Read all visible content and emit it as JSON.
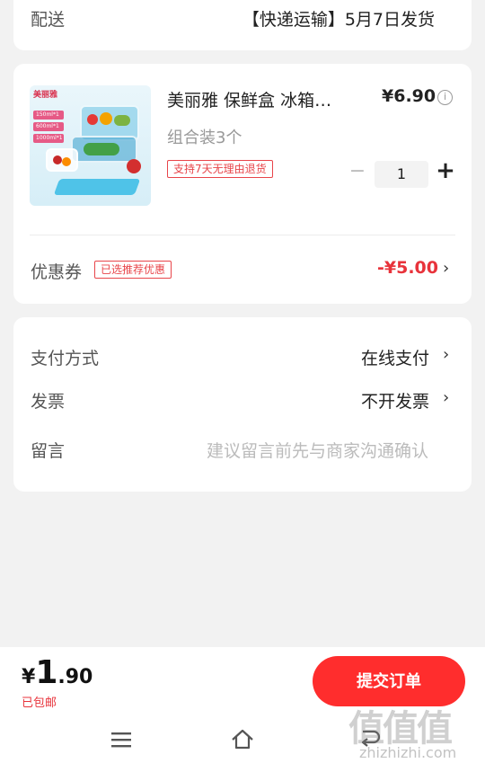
{
  "shipping": {
    "label": "配送",
    "value": "【快递运输】5月7日发货"
  },
  "product": {
    "title": "美丽雅  保鲜盒  冰箱…",
    "subtitle": "组合装3个",
    "badge": "支持7天无理由退货",
    "price": "¥6.90",
    "quantity": "1",
    "thumb": {
      "brand": "美丽雅",
      "tags": [
        "150ml*1",
        "600ml*1",
        "1000ml*1"
      ]
    }
  },
  "coupon": {
    "label": "优惠券",
    "tag": "已选推荐优惠",
    "value": "-¥5.00"
  },
  "payment": {
    "method_label": "支付方式",
    "method_value": "在线支付",
    "invoice_label": "发票",
    "invoice_value": "不开发票",
    "note_label": "留言",
    "note_placeholder": "建议留言前先与商家沟通确认"
  },
  "footer": {
    "currency": "¥",
    "amount_int": "1",
    "amount_dec": ".90",
    "free_shipping": "已包邮",
    "submit_label": "提交订单"
  },
  "watermark": {
    "main": "值值值",
    "sub": "zhizhizhi.com"
  },
  "colors": {
    "accent": "#ff2d2d",
    "price_red": "#e8333b"
  }
}
